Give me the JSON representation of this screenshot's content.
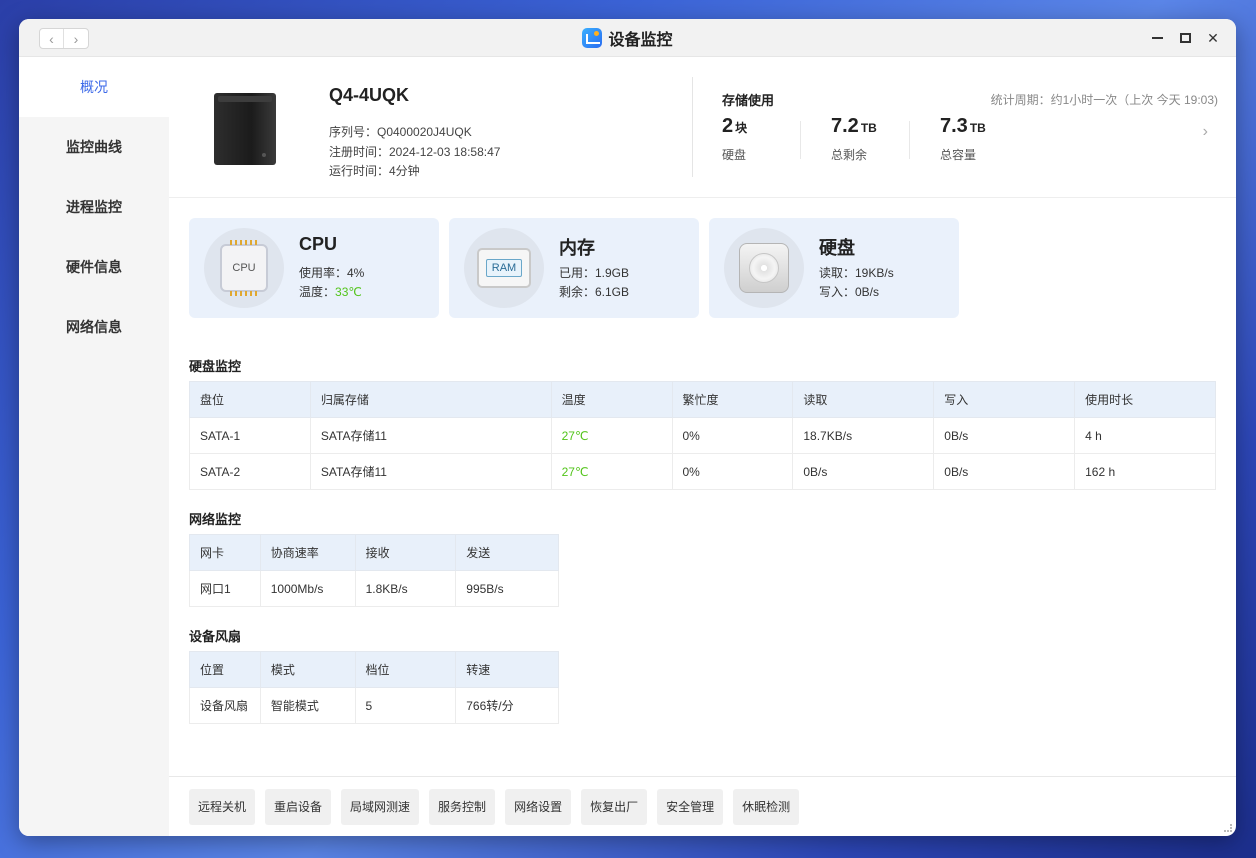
{
  "window": {
    "title": "设备监控",
    "nav_back": "‹",
    "nav_forward": "›",
    "close": "✕"
  },
  "sidebar": {
    "items": [
      {
        "label": "概况",
        "active": true
      },
      {
        "label": "监控曲线"
      },
      {
        "label": "进程监控"
      },
      {
        "label": "硬件信息"
      },
      {
        "label": "网络信息"
      }
    ]
  },
  "device": {
    "name": "Q4-4UQK",
    "serial": "序列号：Q0400020J4UQK",
    "registered": "注册时间：2024-12-03 18:58:47",
    "uptime": "运行时间：4分钟"
  },
  "storage": {
    "title": "存储使用",
    "period": "统计周期：约1小时一次（上次 今天 19:03)",
    "disks_value": "2",
    "disks_unit": "块",
    "disks_label": "硬盘",
    "free_value": "7.2",
    "free_unit": "TB",
    "free_label": "总剩余",
    "total_value": "7.3",
    "total_unit": "TB",
    "total_label": "总容量",
    "chevron": "›"
  },
  "cards": {
    "cpu": {
      "title": "CPU",
      "usage": "使用率：4%",
      "temp_label": "温度：",
      "temp_value": "33℃",
      "chip_label": "CPU"
    },
    "memory": {
      "title": "内存",
      "used": "已用：1.9GB",
      "free": "剩余：6.1GB",
      "chip_label": "RAM"
    },
    "disk": {
      "title": "硬盘",
      "read": "读取：19KB/s",
      "write": "写入：0B/s"
    }
  },
  "disk_monitor": {
    "title": "硬盘监控",
    "headers": [
      "盘位",
      "归属存储",
      "温度",
      "繁忙度",
      "读取",
      "写入",
      "使用时长"
    ],
    "rows": [
      [
        "SATA-1",
        "SATA存储11",
        "27℃",
        "0%",
        "18.7KB/s",
        "0B/s",
        "4 h"
      ],
      [
        "SATA-2",
        "SATA存储11",
        "27℃",
        "0%",
        "0B/s",
        "0B/s",
        "162 h"
      ]
    ]
  },
  "network_monitor": {
    "title": "网络监控",
    "headers": [
      "网卡",
      "协商速率",
      "接收",
      "发送"
    ],
    "rows": [
      [
        "网口1",
        "1000Mb/s",
        "1.8KB/s",
        "995B/s"
      ]
    ]
  },
  "fan": {
    "title": "设备风扇",
    "headers": [
      "位置",
      "模式",
      "档位",
      "转速"
    ],
    "rows": [
      [
        "设备风扇",
        "智能模式",
        "5",
        "766转/分"
      ]
    ]
  },
  "footer": {
    "buttons": [
      "远程关机",
      "重启设备",
      "局域网测速",
      "服务控制",
      "网络设置",
      "恢复出厂",
      "安全管理",
      "休眠检测"
    ]
  },
  "colors": {
    "accent": "#3b68e8",
    "ok": "#52c41a",
    "card_bg": "#eaf1fb",
    "header_bg": "#e8f0fa"
  }
}
